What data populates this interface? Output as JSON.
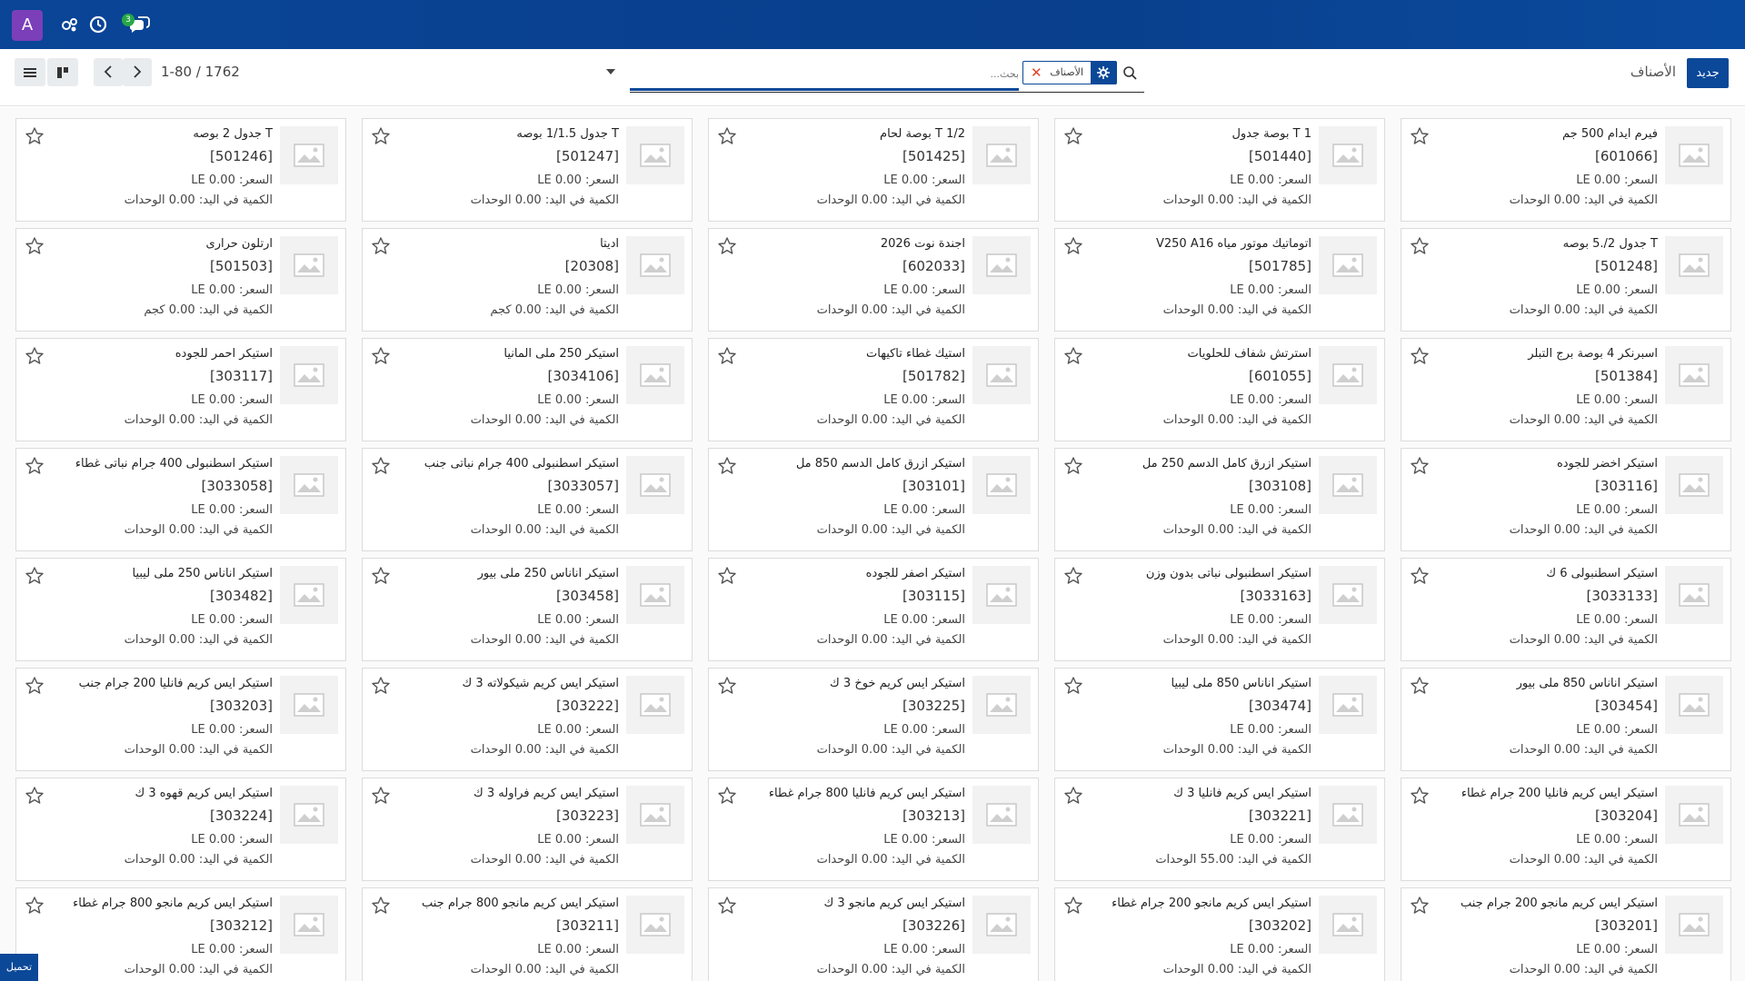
{
  "navbar": {
    "avatar_letter": "A",
    "avatar_color": "#7b3fb9",
    "activity_icon": "settings-cluster-icon",
    "clock_icon": "clock-icon",
    "chat_icon": "chat-icon",
    "chat_badge": "3"
  },
  "control": {
    "new_button": "جديد",
    "breadcrumb": "الأصناف",
    "search": {
      "facet_label": "الأصناف",
      "placeholder": "بحث..."
    },
    "pager": "1-80 / 1762"
  },
  "labels": {
    "price_prefix": "السعر:",
    "currency": "LE",
    "qty_prefix": "الكمية في اليد:"
  },
  "load_more": "تحميل",
  "products": [
    {
      "name": "فيرم ايدام 500 جم",
      "code": "[601066]",
      "price": "0.00",
      "qty": "0.00",
      "unit": "الوحدات"
    },
    {
      "name": "T 1 بوصة جدول",
      "code": "[501440]",
      "price": "0.00",
      "qty": "0.00",
      "unit": "الوحدات"
    },
    {
      "name": "T 1/2 بوصة لحام",
      "code": "[501425]",
      "price": "0.00",
      "qty": "0.00",
      "unit": "الوحدات"
    },
    {
      "name": "T جدول 1/1.5 بوصه",
      "code": "[501247]",
      "price": "0.00",
      "qty": "0.00",
      "unit": "الوحدات"
    },
    {
      "name": "T جدول 2 بوصه",
      "code": "[501246]",
      "price": "0.00",
      "qty": "0.00",
      "unit": "الوحدات"
    },
    {
      "name": "T جدول 2/.5 بوصه",
      "code": "[501248]",
      "price": "0.00",
      "qty": "0.00",
      "unit": "الوحدات"
    },
    {
      "name": "اتوماتيك موتور مياه V250 A16",
      "code": "[501785]",
      "price": "0.00",
      "qty": "0.00",
      "unit": "الوحدات"
    },
    {
      "name": "اجندة نوت 2026",
      "code": "[602033]",
      "price": "0.00",
      "qty": "0.00",
      "unit": "الوحدات"
    },
    {
      "name": "اديتا",
      "code": "[20308]",
      "price": "0.00",
      "qty": "0.00",
      "unit": "كجم"
    },
    {
      "name": "ارتلون حرارى",
      "code": "[501503]",
      "price": "0.00",
      "qty": "0.00",
      "unit": "كجم"
    },
    {
      "name": "اسبرنكر 4 بوصة برج التبلر",
      "code": "[501384]",
      "price": "0.00",
      "qty": "0.00",
      "unit": "الوحدات"
    },
    {
      "name": "استرتش شفاف للحلويات",
      "code": "[601055]",
      "price": "0.00",
      "qty": "0.00",
      "unit": "الوحدات"
    },
    {
      "name": "استيك غطاء تاكيهات",
      "code": "[501782]",
      "price": "0.00",
      "qty": "0.00",
      "unit": "الوحدات"
    },
    {
      "name": "استيكر 250 ملى المانيا",
      "code": "[3034106]",
      "price": "0.00",
      "qty": "0.00",
      "unit": "الوحدات"
    },
    {
      "name": "استيكر احمر للجوده",
      "code": "[303117]",
      "price": "0.00",
      "qty": "0.00",
      "unit": "الوحدات"
    },
    {
      "name": "استيكر اخضر للجوده",
      "code": "[303116]",
      "price": "0.00",
      "qty": "0.00",
      "unit": "الوحدات"
    },
    {
      "name": "استيكر ازرق كامل الدسم 250 مل",
      "code": "[303108]",
      "price": "0.00",
      "qty": "0.00",
      "unit": "الوحدات"
    },
    {
      "name": "استيكر ازرق كامل الدسم 850 مل",
      "code": "[303101]",
      "price": "0.00",
      "qty": "0.00",
      "unit": "الوحدات"
    },
    {
      "name": "استيكر اسطنبولى 400 جرام نباتى جنب",
      "code": "[3033057]",
      "price": "0.00",
      "qty": "0.00",
      "unit": "الوحدات"
    },
    {
      "name": "استيكر اسطنبولى 400 جرام نباتى غطاء",
      "code": "[3033058]",
      "price": "0.00",
      "qty": "0.00",
      "unit": "الوحدات"
    },
    {
      "name": "استيكر اسطنبولى 6 ك",
      "code": "[3033133]",
      "price": "0.00",
      "qty": "0.00",
      "unit": "الوحدات"
    },
    {
      "name": "استيكر اسطنبولى نباتى بدون وزن",
      "code": "[3033163]",
      "price": "0.00",
      "qty": "0.00",
      "unit": "الوحدات"
    },
    {
      "name": "استيكر اصفر للجوده",
      "code": "[303115]",
      "price": "0.00",
      "qty": "0.00",
      "unit": "الوحدات"
    },
    {
      "name": "استيكر اناناس 250 ملى بيور",
      "code": "[303458]",
      "price": "0.00",
      "qty": "0.00",
      "unit": "الوحدات"
    },
    {
      "name": "استيكر اناناس 250 ملى ليبيا",
      "code": "[303482]",
      "price": "0.00",
      "qty": "0.00",
      "unit": "الوحدات"
    },
    {
      "name": "استيكر اناناس 850 ملى بيور",
      "code": "[303454]",
      "price": "0.00",
      "qty": "0.00",
      "unit": "الوحدات"
    },
    {
      "name": "استيكر اناناس 850 ملى ليبيا",
      "code": "[303474]",
      "price": "0.00",
      "qty": "0.00",
      "unit": "الوحدات"
    },
    {
      "name": "استيكر ايس كريم خوخ 3 ك",
      "code": "[303225]",
      "price": "0.00",
      "qty": "0.00",
      "unit": "الوحدات"
    },
    {
      "name": "استيكر ايس كريم شيكولاته 3 ك",
      "code": "[303222]",
      "price": "0.00",
      "qty": "0.00",
      "unit": "الوحدات"
    },
    {
      "name": "استيكر ايس كريم فانليا 200 جرام جنب",
      "code": "[303203]",
      "price": "0.00",
      "qty": "0.00",
      "unit": "الوحدات"
    },
    {
      "name": "استيكر ايس كريم فانليا 200 جرام غطاء",
      "code": "[303204]",
      "price": "0.00",
      "qty": "0.00",
      "unit": "الوحدات"
    },
    {
      "name": "استيكر ايس كريم فانليا 3 ك",
      "code": "[303221]",
      "price": "0.00",
      "qty": "55.00",
      "unit": "الوحدات"
    },
    {
      "name": "استيكر ايس كريم فانليا 800 جرام غطاء",
      "code": "[303213]",
      "price": "0.00",
      "qty": "0.00",
      "unit": "الوحدات"
    },
    {
      "name": "استيكر ايس كريم فراوله 3 ك",
      "code": "[303223]",
      "price": "0.00",
      "qty": "0.00",
      "unit": "الوحدات"
    },
    {
      "name": "استيكر ايس كريم قهوه 3 ك",
      "code": "[303224]",
      "price": "0.00",
      "qty": "0.00",
      "unit": "الوحدات"
    },
    {
      "name": "استيكر ايس كريم مانجو 200 جرام جنب",
      "code": "[303201]",
      "price": "0.00",
      "qty": "0.00",
      "unit": "الوحدات"
    },
    {
      "name": "استيكر ايس كريم مانجو 200 جرام غطاء",
      "code": "[303202]",
      "price": "0.00",
      "qty": "0.00",
      "unit": "الوحدات"
    },
    {
      "name": "استيكر ايس كريم مانجو 3 ك",
      "code": "[303226]",
      "price": "0.00",
      "qty": "0.00",
      "unit": "الوحدات"
    },
    {
      "name": "استيكر ايس كريم مانجو 800 جرام جنب",
      "code": "[303211]",
      "price": "0.00",
      "qty": "0.00",
      "unit": "الوحدات"
    },
    {
      "name": "استيكر ايس كريم مانجو 800 جرام غطاء",
      "code": "[303212]",
      "price": "0.00",
      "qty": "0.00",
      "unit": "الوحدات"
    }
  ]
}
